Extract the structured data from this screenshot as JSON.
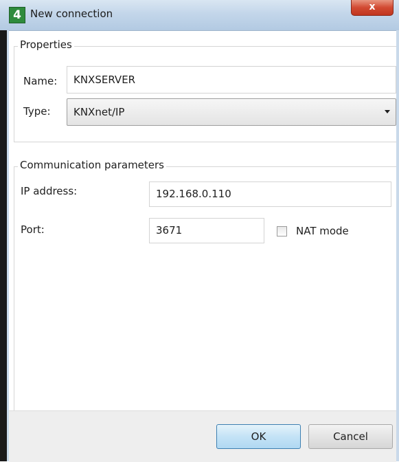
{
  "window": {
    "title": "New connection",
    "app_icon_glyph": "4",
    "close_glyph": "x"
  },
  "properties": {
    "legend": "Properties",
    "name_label": "Name:",
    "name_value": "KNXSERVER",
    "type_label": "Type:",
    "type_value": "KNXnet/IP"
  },
  "communication": {
    "legend": "Communication parameters",
    "ip_label": "IP address:",
    "ip_value": "192.168.0.110",
    "port_label": "Port:",
    "port_value": "3671",
    "nat_label": "NAT mode",
    "nat_checked": false
  },
  "buttons": {
    "ok": "OK",
    "cancel": "Cancel"
  },
  "icons": {
    "app": "app-logo-icon",
    "close": "close-icon",
    "dropdown": "chevron-down-icon"
  }
}
